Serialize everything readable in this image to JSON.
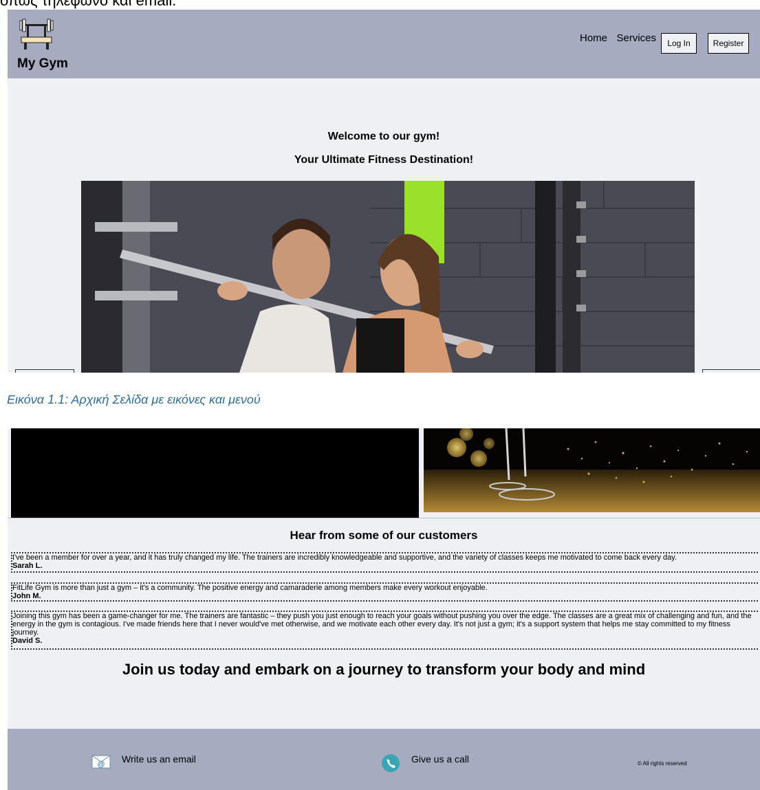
{
  "top_caption": "όπως τηλέφωνο και email.",
  "header": {
    "brand": "My Gym",
    "nav": {
      "home": "Home",
      "services": "Services",
      "login": "Log In",
      "register": "Register"
    }
  },
  "hero": {
    "welcome": "Welcome to our gym!",
    "tagline": "Your Ultimate Fitness Destination!"
  },
  "figure_caption": "Εικόνα 1.1: Αρχική Σελίδα με εικόνες και μενού",
  "customers": {
    "title": "Hear from some of our customers",
    "testimonials": [
      {
        "text": "I've been a member for over a year, and it has truly changed my life. The trainers are incredibly knowledgeable and supportive, and the variety of classes keeps me motivated to come back every day.",
        "author": "Sarah L."
      },
      {
        "text": "FitLife Gym is more than just a gym – it's a community. The positive energy and camaraderie among members make every workout enjoyable.",
        "author": "John M."
      },
      {
        "text": "Joining this gym has been a game-changer for me. The trainers are fantastic – they push you just enough to reach your goals without pushing you over the edge. The classes are a great mix of challenging and fun, and the energy in the gym is contagious. I've made friends here that I never would've met otherwise, and we motivate each other every day. It's not just a gym; it's a support system that helps me stay committed to my fitness journey.",
        "author": "David S."
      }
    ]
  },
  "join_text": "Join us today and embark on a journey to transform your body and mind",
  "footer": {
    "email": "Write us an email",
    "call": "Give us a call",
    "rights": "© All rights reserved"
  },
  "colors": {
    "header_bg": "#a6abbf",
    "page_bg": "#eef0f3",
    "caption": "#2e6e9e"
  }
}
